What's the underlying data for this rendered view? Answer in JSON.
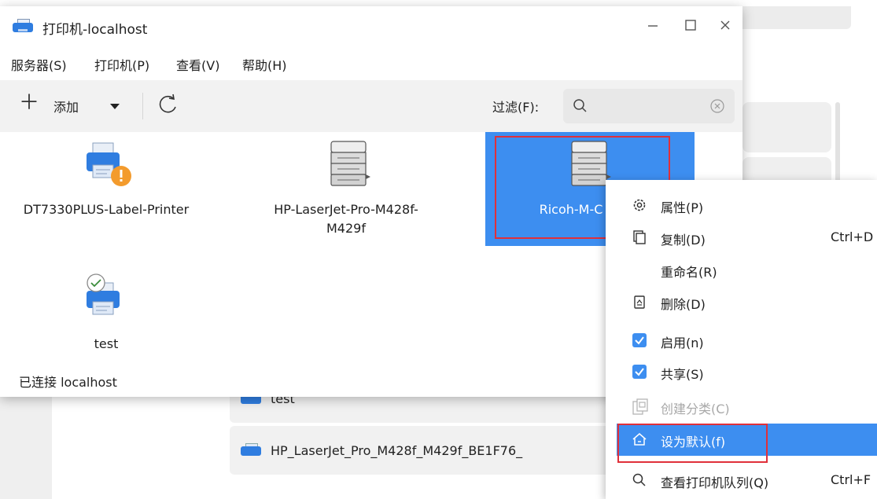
{
  "window": {
    "title": "打印机-localhost",
    "controls": [
      "minimize-icon",
      "maximize-icon",
      "close-icon"
    ]
  },
  "menubar": {
    "items": [
      "服务器(S)",
      "打印机(P)",
      "查看(V)",
      "帮助(H)"
    ]
  },
  "toolbar": {
    "add_label": "添加",
    "filter_label": "过滤(F):",
    "search_value": ""
  },
  "printers": [
    {
      "name": "DT7330PLUS-Label-Printer",
      "icon": "printer-warning-icon",
      "selected": false
    },
    {
      "name": "HP-LaserJet-Pro-M428f-M429f",
      "name_line1": "HP-LaserJet-Pro-M428f-",
      "name_line2": "M429f",
      "icon": "laser-printer-icon",
      "selected": false
    },
    {
      "name": "Ricoh-M-C",
      "icon": "laser-printer-icon",
      "selected": true
    },
    {
      "name": "test",
      "icon": "printer-ok-icon",
      "selected": false
    }
  ],
  "status": {
    "text": "已连接 localhost"
  },
  "background": {
    "rows": [
      "test",
      "HP_LaserJet_Pro_M428f_M429f_BE1F76_"
    ]
  },
  "context_menu": {
    "items": [
      {
        "label": "属性(P)",
        "shortcut": "",
        "icon": "gear-icon",
        "state": "normal"
      },
      {
        "label": "复制(D)",
        "shortcut": "Ctrl+D",
        "icon": "copy-icon",
        "state": "normal"
      },
      {
        "label": "重命名(R)",
        "shortcut": "",
        "icon": "",
        "state": "normal"
      },
      {
        "label": "删除(D)",
        "shortcut": "",
        "icon": "trash-icon",
        "state": "normal"
      },
      {
        "label": "启用(n)",
        "shortcut": "",
        "icon": "checkbox-checked-icon",
        "state": "checked"
      },
      {
        "label": "共享(S)",
        "shortcut": "",
        "icon": "checkbox-checked-icon",
        "state": "checked"
      },
      {
        "label": "创建分类(C)",
        "shortcut": "",
        "icon": "copy-icon",
        "state": "disabled"
      },
      {
        "label": "设为默认(f)",
        "shortcut": "",
        "icon": "home-icon",
        "state": "hover"
      },
      {
        "label": "查看打印机队列(Q)",
        "shortcut": "Ctrl+F",
        "icon": "search-icon",
        "state": "normal"
      }
    ]
  },
  "colors": {
    "accent": "#3d8ef0",
    "annotation": "#e0303a",
    "toolbar_bg": "#f2f2f2"
  }
}
